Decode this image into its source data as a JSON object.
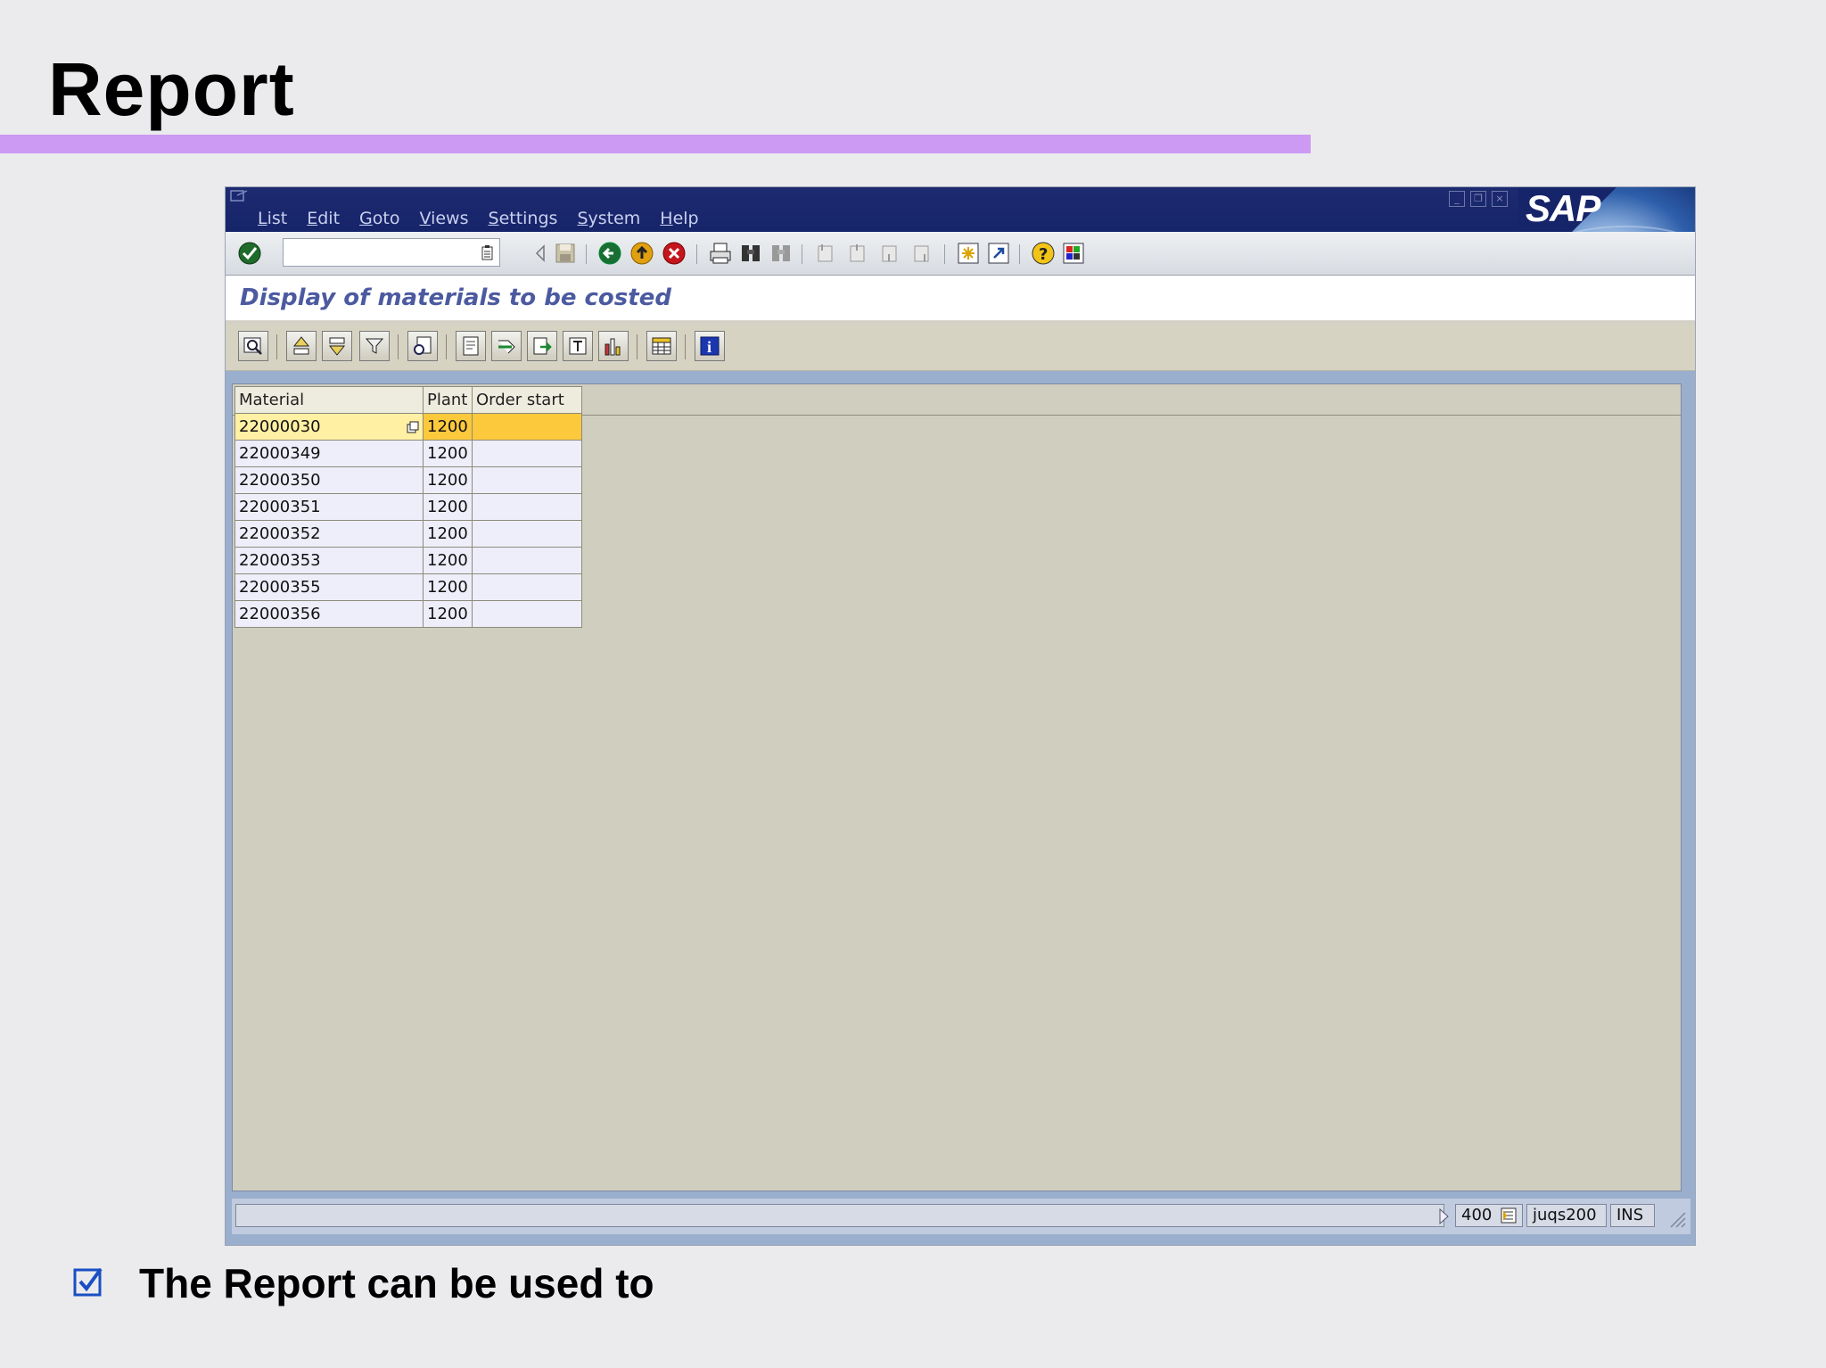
{
  "slide": {
    "title": "Report",
    "bullet": "The Report can be used to",
    "accent_color": "#cc99f3"
  },
  "sap": {
    "logo_text": "SAP",
    "menu": [
      {
        "first": "L",
        "rest": "ist"
      },
      {
        "first": "E",
        "rest": "dit"
      },
      {
        "first": "G",
        "rest": "oto"
      },
      {
        "first": "V",
        "rest": "iews"
      },
      {
        "first": "S",
        "rest": "ettings"
      },
      {
        "first": "S",
        "rest": "ystem"
      },
      {
        "first": "H",
        "rest": "elp"
      }
    ],
    "command_field": {
      "value": ""
    },
    "screen_title": "Display of materials to be costed",
    "grid": {
      "columns": [
        "Material",
        "Plant",
        "Order start"
      ],
      "rows": [
        {
          "material": "22000030",
          "plant": "1200",
          "order_start": ""
        },
        {
          "material": "22000349",
          "plant": "1200",
          "order_start": ""
        },
        {
          "material": "22000350",
          "plant": "1200",
          "order_start": ""
        },
        {
          "material": "22000351",
          "plant": "1200",
          "order_start": ""
        },
        {
          "material": "22000352",
          "plant": "1200",
          "order_start": ""
        },
        {
          "material": "22000353",
          "plant": "1200",
          "order_start": ""
        },
        {
          "material": "22000355",
          "plant": "1200",
          "order_start": ""
        },
        {
          "material": "22000356",
          "plant": "1200",
          "order_start": ""
        }
      ]
    },
    "status": {
      "client": "400",
      "server": "juqs200",
      "mode": "INS"
    },
    "colors": {
      "titlebar": "#16246a",
      "screen_title": "#4c5aa0",
      "selected_cell": "#fcc93d",
      "selected_key_cell": "#fff0a4"
    }
  }
}
